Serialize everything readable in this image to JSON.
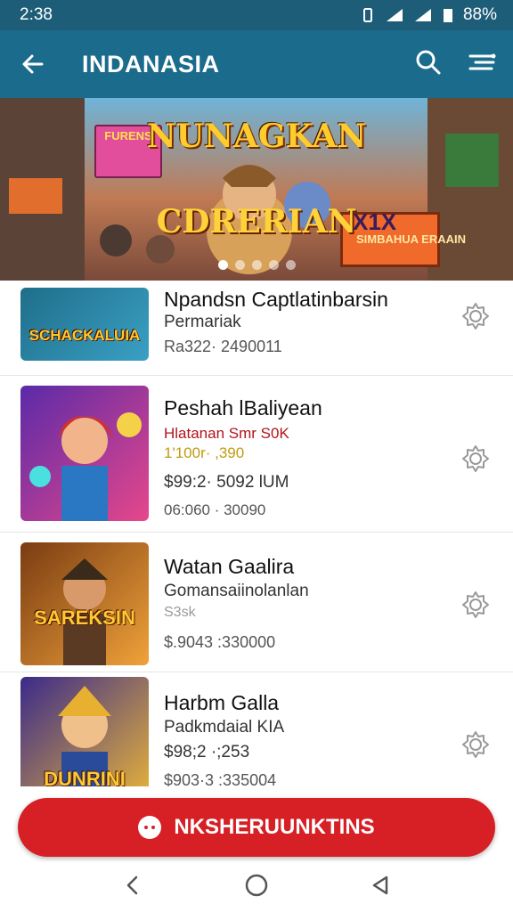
{
  "status": {
    "time": "2:38",
    "battery": "88%"
  },
  "app_bar": {
    "title": "INDANASIA"
  },
  "banner": {
    "title": "NUNAGKAN",
    "subtitle": "CDRERIAN",
    "sign_left": "FURENS",
    "sign_right": "SIMBAHUA ERAAIN",
    "badge": "X1X",
    "dots": 5,
    "active_dot": 0
  },
  "items": [
    {
      "title": "Npandsn Captlatinbarsin",
      "subtitle": "Permariak",
      "meta": "",
      "price": "Ra322· 2490011",
      "thumb_label": "SCHACKALUIA",
      "thumb_colors": [
        "#1f6e8a",
        "#3aa0c4"
      ]
    },
    {
      "title": "Peshah lBaliyean",
      "subtitle": "Hlatanan Smr S0K",
      "meta": "1'100r· ,390",
      "price": "$99:2· 5092 lUM",
      "extra": "06:060 · 30090",
      "thumb_label": "",
      "thumb_colors": [
        "#5a2aa8",
        "#e7478b"
      ]
    },
    {
      "title": "Watan Gaalira",
      "subtitle": "Gomansaiinolanlan",
      "meta": "S3sk",
      "price": "$.9043 :330000",
      "thumb_label": "SAREKSIN",
      "thumb_colors": [
        "#7a3c12",
        "#f0a23a"
      ]
    },
    {
      "title": "Harbm Galla",
      "subtitle": "Padkmdaial KIA",
      "meta": "$98;2 ·;253",
      "price": "$903·3 :335004",
      "thumb_label": "DUNRINI",
      "thumb_colors": [
        "#3a2a8a",
        "#e7b33a"
      ]
    }
  ],
  "cta": {
    "label": "NKSHERUUNKTINS"
  },
  "colors": {
    "app_bar": "#1b6b8c",
    "status_bar": "#1e5d78",
    "cta": "#d62025"
  }
}
